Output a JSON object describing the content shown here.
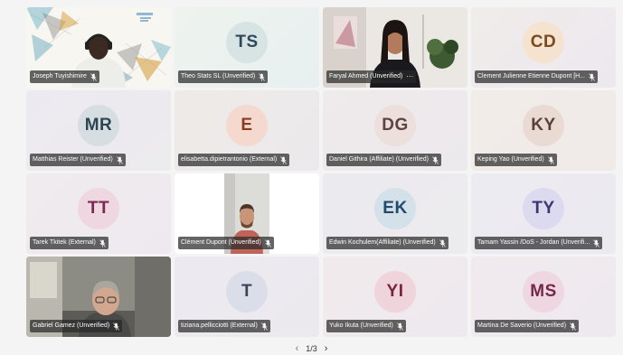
{
  "participants": [
    {
      "name": "Joseph Tuyishimire",
      "type": "video",
      "bg": "#f6f6f2"
    },
    {
      "name": "Theo Stats SL (Unverified)",
      "initials": "TS",
      "bg": "#e7efeb",
      "avatar_bg": "#d7e2e3",
      "avatar_fg": "#2e4a5a"
    },
    {
      "name": "Faryal Ahmed (Unverified)",
      "type": "video",
      "more": "···",
      "bg": "#e9e7e4"
    },
    {
      "name": "Clement Julienne Etienne Dupont [H...",
      "initials": "CD",
      "bg": "#f1ece8",
      "avatar_bg": "#f4e1cf",
      "avatar_fg": "#7a4a1e"
    },
    {
      "name": "Matthias Reister (Unverified)",
      "initials": "MR",
      "bg": "#ece9ef",
      "avatar_bg": "#d6dde0",
      "avatar_fg": "#2e4651"
    },
    {
      "name": "elisabetta.dipietrantonio (External)",
      "initials": "E",
      "bg": "#ede9e6",
      "avatar_bg": "#f5d8cf",
      "avatar_fg": "#8a3c22"
    },
    {
      "name": "Daniel Githira (Affiliate) (Unverified)",
      "initials": "DG",
      "bg": "#eeeaec",
      "avatar_bg": "#ecdedb",
      "avatar_fg": "#5d4440"
    },
    {
      "name": "Keping Yao (Unverified)",
      "initials": "KY",
      "bg": "#f0ebe9",
      "avatar_bg": "#ead9d4",
      "avatar_fg": "#5b4036"
    },
    {
      "name": "Tarek Tkitek (External)",
      "initials": "TT",
      "bg": "#efeaee",
      "avatar_bg": "#efd6e2",
      "avatar_fg": "#7a2a52"
    },
    {
      "name": "Clément Dupont (Unverified)",
      "type": "video",
      "bg": "#ffffff"
    },
    {
      "name": "Edwin Kochulem(Affiliate) (Unverified)",
      "initials": "EK",
      "bg": "#eae9ee",
      "avatar_bg": "#d3e0ea",
      "avatar_fg": "#224a69"
    },
    {
      "name": "Tamam Yassin /DoS - Jordan (Unverifi...",
      "initials": "TY",
      "bg": "#ebeaf0",
      "avatar_bg": "#dbd9ee",
      "avatar_fg": "#3a3672"
    },
    {
      "name": "Gabriel Gamez (Unverified)",
      "type": "video",
      "bg": "#8b8a84"
    },
    {
      "name": "tiziana.pellicciotti (External)",
      "initials": "T",
      "bg": "#eceaf0",
      "avatar_bg": "#dadde8",
      "avatar_fg": "#3b4359"
    },
    {
      "name": "Yuko Ikuta (Unverified)",
      "initials": "YI",
      "bg": "#efe9ec",
      "avatar_bg": "#f0d3db",
      "avatar_fg": "#7a2440"
    },
    {
      "name": "Martina De Saverio (Unverified)",
      "initials": "MS",
      "bg": "#efe9ee",
      "avatar_bg": "#efd6e0",
      "avatar_fg": "#74284a"
    }
  ],
  "pager": {
    "prev": "‹",
    "text": "1/3",
    "next": "›"
  },
  "icons": {
    "mic": "mic-off-icon",
    "more": "more-options-icon"
  }
}
